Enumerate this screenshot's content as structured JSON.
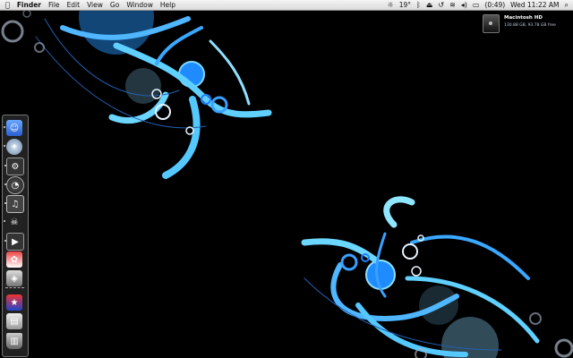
{
  "menubar": {
    "apple_icon": "apple-icon",
    "app_name": "Finder",
    "menus": [
      "File",
      "Edit",
      "View",
      "Go",
      "Window",
      "Help"
    ],
    "status": {
      "temperature": "19°",
      "battery": "(0:49)",
      "clock": "Wed 11:22 AM"
    }
  },
  "desktop": {
    "drive_name": "Macintosh HD",
    "drive_info": "130.88 GB, 93.78 GB free",
    "accent_color": "#35c4ff"
  },
  "dock": {
    "items": [
      "finder-icon",
      "safari-icon",
      "dashboard-icon",
      "system-preferences-icon",
      "itunes-icon",
      "skull-app-icon",
      "facetime-icon",
      "photo-app-icon",
      "preview-icon",
      "app-icon",
      "documents-folder-icon",
      "trash-icon"
    ]
  }
}
